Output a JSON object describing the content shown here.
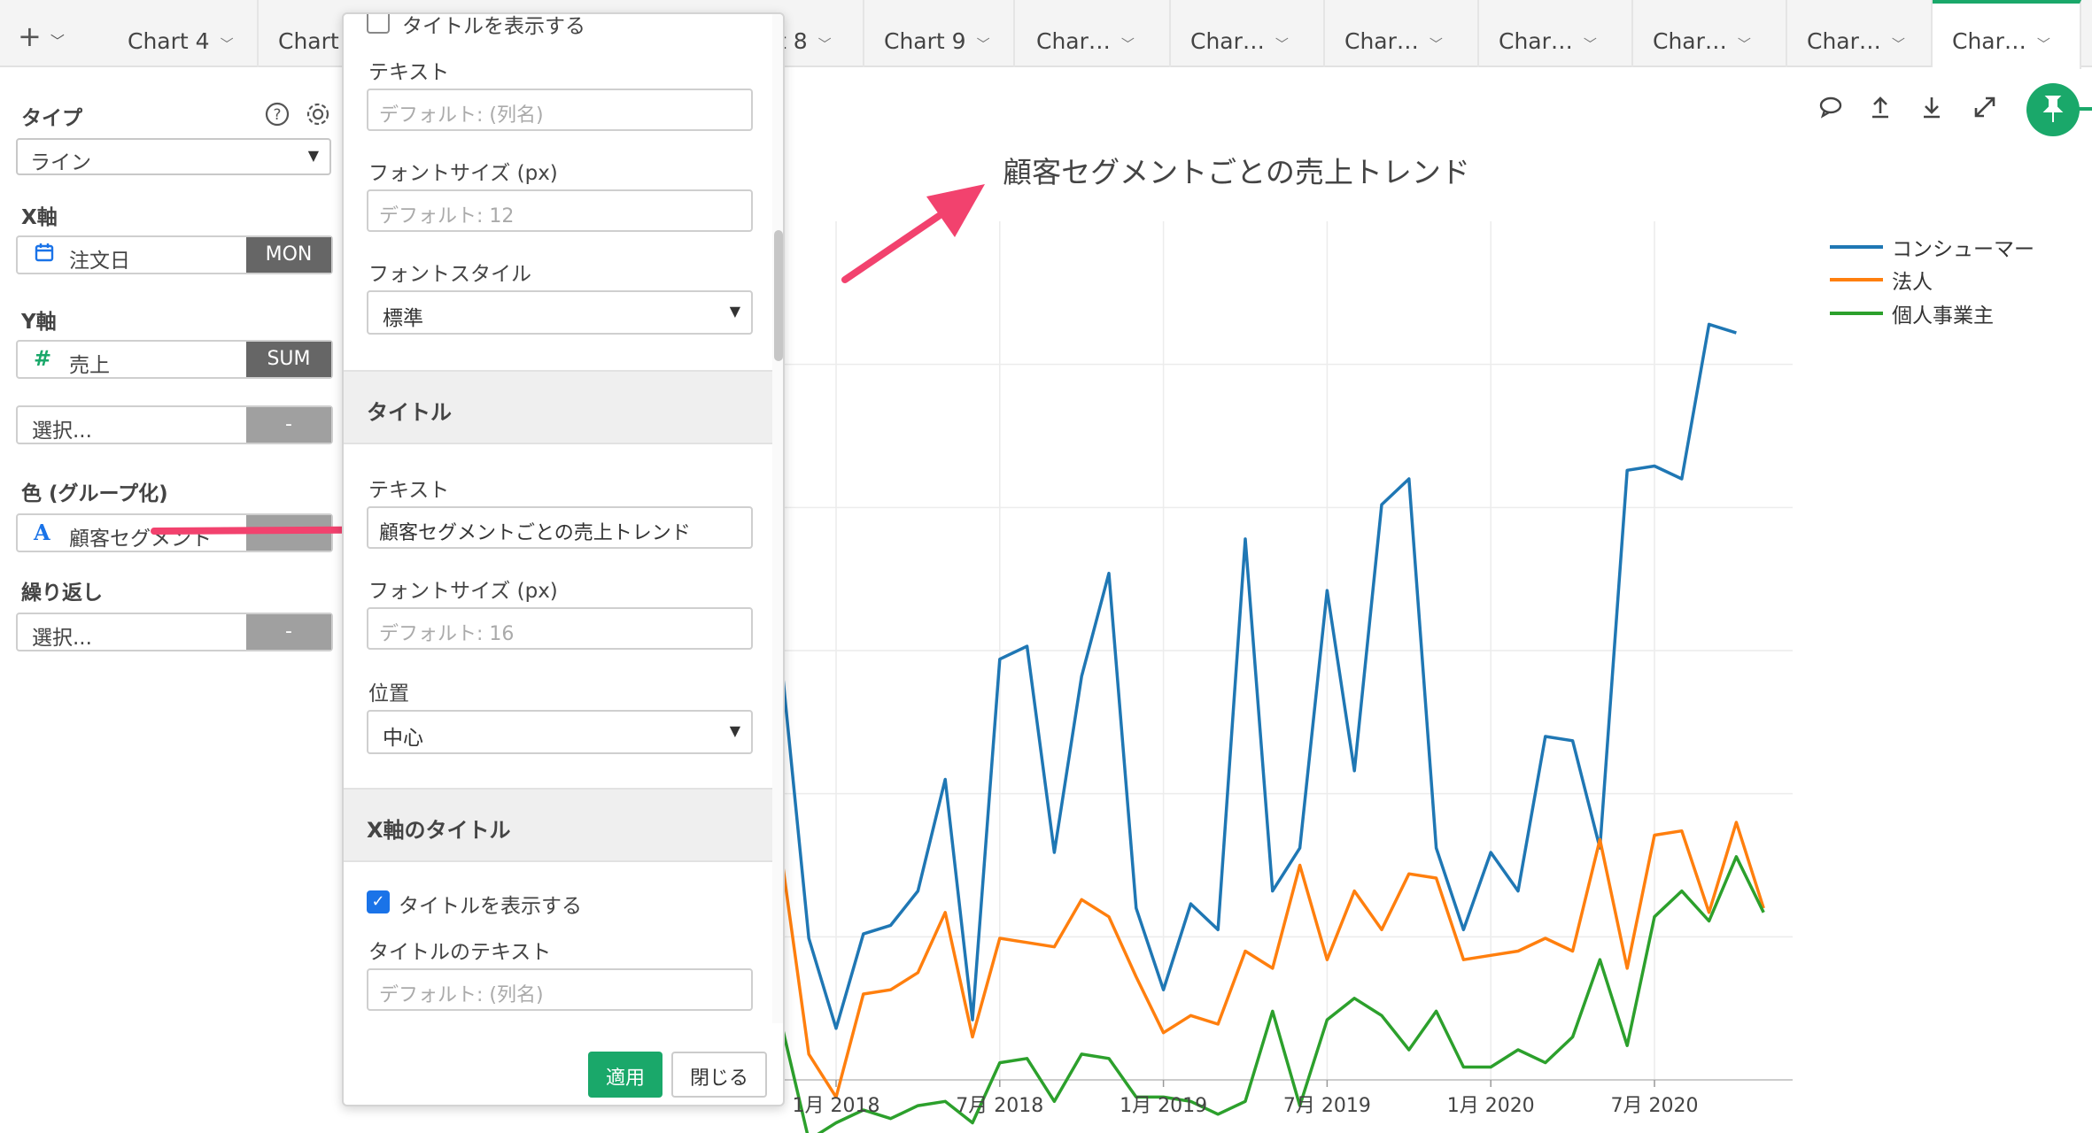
{
  "tabbar": {
    "add_label": "+",
    "tabs": [
      {
        "label": "Chart 4"
      },
      {
        "label": "Chart"
      },
      {
        "label": "t 8"
      },
      {
        "label": "Chart 9"
      },
      {
        "label": "Char…"
      },
      {
        "label": "Char…"
      },
      {
        "label": "Char…"
      },
      {
        "label": "Char…"
      },
      {
        "label": "Char…"
      },
      {
        "label": "Char…"
      },
      {
        "label": "Char…"
      }
    ]
  },
  "left_panel": {
    "type_label": "タイプ",
    "type_value": "ライン",
    "x_label": "X軸",
    "x_field": "注文日",
    "x_func": "MON",
    "y_label": "Y軸",
    "y_field": "売上",
    "y_func": "SUM",
    "y2_placeholder": "選択...",
    "y2_func": "-",
    "color_label": "色 (グループ化)",
    "color_field": "顧客セグメント",
    "repeat_label": "繰り返し",
    "repeat_placeholder": "選択...",
    "repeat_func": "-"
  },
  "popup": {
    "top_checkbox_label": "タイトルを表示する",
    "text_label": "テキスト",
    "text_placeholder": "デフォルト: (列名)",
    "fontsize_label": "フォントサイズ (px)",
    "fontsize_placeholder": "デフォルト: 12",
    "fontstyle_label": "フォントスタイル",
    "fontstyle_value": "標準",
    "title_section": "タイトル",
    "title_text_label": "テキスト",
    "title_text_value": "顧客セグメントごとの売上トレンド",
    "title_fontsize_label": "フォントサイズ (px)",
    "title_fontsize_placeholder": "デフォルト: 16",
    "position_label": "位置",
    "position_value": "中心",
    "xaxis_section": "X軸のタイトル",
    "show_title_label": "タイトルを表示する",
    "xaxis_title_text_label": "タイトルのテキスト",
    "xaxis_title_placeholder": "デフォルト: (列名)",
    "apply_label": "適用",
    "close_label": "閉じる"
  },
  "colors": {
    "accent": "#1aa86a",
    "arrow": "#f2426e",
    "consumer": "#1f77b4",
    "corporate": "#ff7f0e",
    "home_office": "#2ca02c"
  },
  "toolbar_icons": [
    "comment-icon",
    "upload-icon",
    "download-icon",
    "expand-icon",
    "pin-icon"
  ],
  "chart_data": {
    "type": "line",
    "title": "顧客セグメントごとの売上トレンド",
    "x_tick_labels": [
      "1月 2018",
      "7月 2018",
      "1月 2019",
      "7月 2019",
      "1月 2020",
      "7月 2020"
    ],
    "y_range": [
      0,
      100
    ],
    "grid": true,
    "legend_position": "top-right",
    "x_first_visible": "2017-10",
    "x_last_visible": "2020-12",
    "series": [
      {
        "name": "コンシューマー",
        "values": [
          49,
          48.5,
          16.5,
          6,
          17,
          18,
          22,
          35,
          7,
          49,
          50.5,
          26.5,
          47,
          59,
          20,
          10.5,
          20.5,
          17.5,
          63,
          22,
          27,
          57,
          36,
          67,
          70,
          27,
          17.5,
          26.5,
          22,
          40,
          39.5,
          27,
          71,
          71.5,
          70,
          88,
          87
        ]
      },
      {
        "name": "法人",
        "values": [
          15,
          26,
          3,
          -2,
          10,
          10.5,
          12.5,
          19.5,
          5,
          16.5,
          16,
          15.5,
          21,
          19,
          12,
          5.5,
          7.5,
          6.5,
          15,
          13,
          25,
          14,
          22,
          17.5,
          24,
          23.5,
          14,
          14.5,
          15,
          16.5,
          15,
          28,
          13,
          28.5,
          29,
          19.5,
          30,
          20
        ]
      },
      {
        "name": "個人事業主",
        "values": [
          9,
          6.5,
          -7,
          -5,
          -3.5,
          -4.5,
          -3,
          -2.5,
          -5,
          2,
          2.5,
          -2.5,
          3,
          2.5,
          -2,
          -2,
          -2.5,
          -4,
          -2.5,
          8,
          -3,
          7,
          9.5,
          7.5,
          3.5,
          8,
          1.5,
          1.5,
          3.5,
          2,
          5,
          14,
          4,
          19,
          22,
          18.5,
          26,
          19.5
        ]
      }
    ]
  },
  "series_labels": {
    "consumer": "コンシューマー",
    "corporate": "法人",
    "home_office": "個人事業主"
  }
}
